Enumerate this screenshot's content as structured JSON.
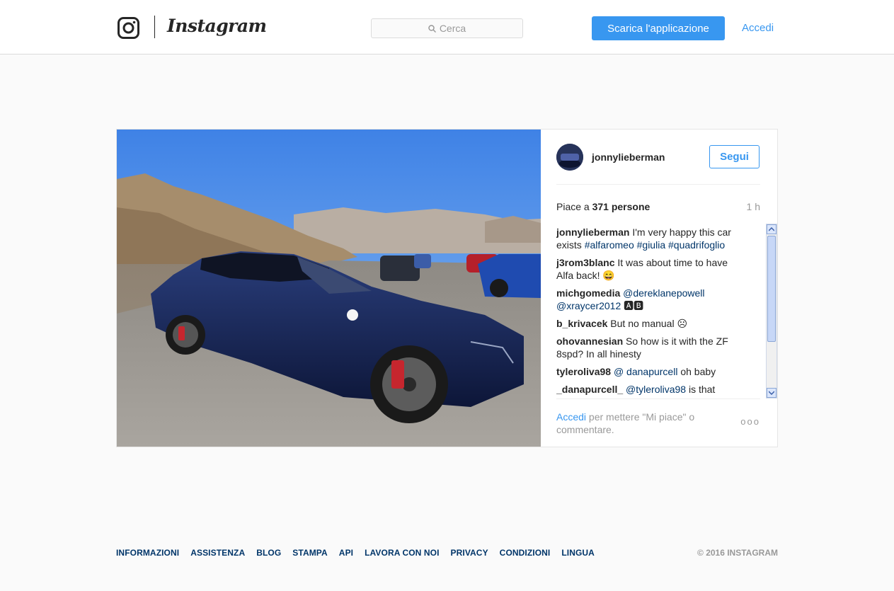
{
  "header": {
    "brand": "Instagram",
    "search_placeholder": "Cerca",
    "app_button": "Scarica l'applicazione",
    "login": "Accedi"
  },
  "post": {
    "username": "jonnylieberman",
    "follow_label": "Segui",
    "likes_prefix": "Piace a",
    "likes_count": "371 persone",
    "time": "1 h",
    "comments": [
      {
        "user": "jonnylieberman",
        "parts": [
          {
            "text": "I'm very happy this car exists ",
            "tag": false
          },
          {
            "text": "#alfaromeo",
            "tag": true
          },
          {
            "text": " ",
            "tag": false
          },
          {
            "text": "#giulia",
            "tag": true
          },
          {
            "text": " ",
            "tag": false
          },
          {
            "text": "#quadrifoglio",
            "tag": true
          }
        ]
      },
      {
        "user": "j3rom3blanc",
        "parts": [
          {
            "text": "It was about time to have Alfa back! 😄",
            "tag": false
          }
        ]
      },
      {
        "user": "michgomedia",
        "parts": [
          {
            "text": "@dereklanepowell",
            "tag": true
          },
          {
            "text": " ",
            "tag": false
          },
          {
            "text": "@xraycer2012",
            "tag": true
          },
          {
            "text": " 🅰🅱",
            "tag": false
          }
        ]
      },
      {
        "user": "b_krivacek",
        "parts": [
          {
            "text": "But no manual ☹",
            "tag": false
          }
        ]
      },
      {
        "user": "ohovannesian",
        "parts": [
          {
            "text": "So how is it with the ZF 8spd? In all hinesty",
            "tag": false
          }
        ]
      },
      {
        "user": "tyleroliva98",
        "parts": [
          {
            "text": "@  danapurcell",
            "tag": true
          },
          {
            "text": "   oh baby",
            "tag": false
          }
        ]
      },
      {
        "user": "_danapurcell_",
        "parts": [
          {
            "text": "@tyleroliva98",
            "tag": true
          },
          {
            "text": " is that",
            "tag": false
          }
        ]
      }
    ],
    "footer_login": "Accedi",
    "footer_text": " per mettere \"Mi piace\" o commentare.",
    "more": "ooo"
  },
  "footer": {
    "links": [
      "INFORMAZIONI",
      "ASSISTENZA",
      "BLOG",
      "STAMPA",
      "API",
      "LAVORA CON NOI",
      "PRIVACY",
      "CONDIZIONI",
      "LINGUA"
    ],
    "copyright": "© 2016 INSTAGRAM"
  }
}
